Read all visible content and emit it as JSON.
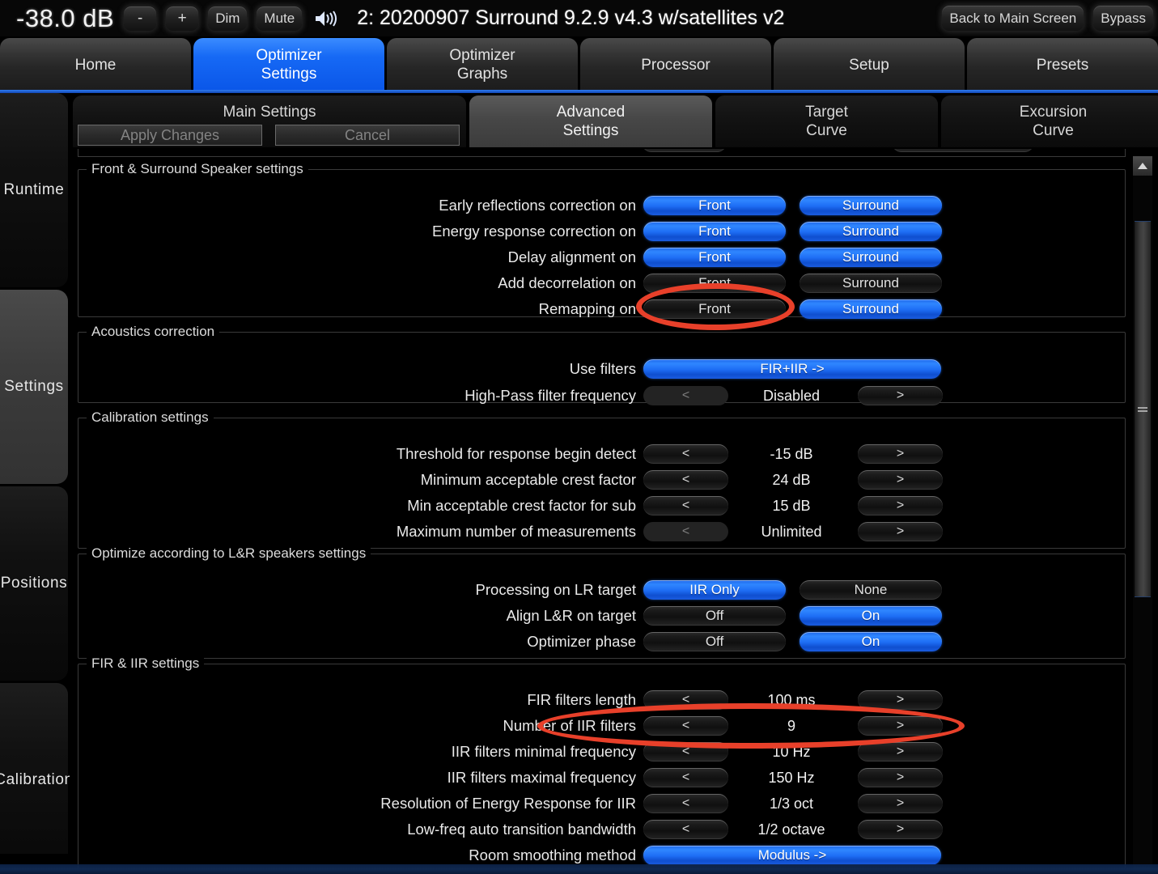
{
  "header": {
    "volume": "-38.0 dB",
    "minus_label": "-",
    "plus_label": "+",
    "dim_label": "Dim",
    "mute_label": "Mute",
    "speaker_icon": "speaker-volume-icon",
    "title": "2: 20200907 Surround 9.2.9 v4.3 w/satellites v2",
    "back_label": "Back to Main Screen",
    "bypass_label": "Bypass"
  },
  "main_tabs": [
    {
      "line1": "Home",
      "line2": "",
      "active": false
    },
    {
      "line1": "Optimizer",
      "line2": "Settings",
      "active": true
    },
    {
      "line1": "Optimizer",
      "line2": "Graphs",
      "active": false
    },
    {
      "line1": "Processor",
      "line2": "",
      "active": false
    },
    {
      "line1": "Setup",
      "line2": "",
      "active": false
    },
    {
      "line1": "Presets",
      "line2": "",
      "active": false
    }
  ],
  "sidebar": {
    "items": [
      {
        "label": "Runtime",
        "active": false
      },
      {
        "label": "Settings",
        "active": true
      },
      {
        "label": "Positions",
        "active": false
      },
      {
        "label": "Calibration",
        "active": false
      }
    ]
  },
  "sub_tabs": [
    {
      "line1": "Main Settings",
      "line2": "",
      "active": false
    },
    {
      "line1": "Advanced",
      "line2": "Settings",
      "active": true
    },
    {
      "line1": "Target",
      "line2": "Curve",
      "active": false
    },
    {
      "line1": "Excursion",
      "line2": "Curve",
      "active": false
    }
  ],
  "actions": {
    "apply_label": "Apply Changes",
    "cancel_label": "Cancel"
  },
  "sections": {
    "front_surround": {
      "legend": "Front & Surround Speaker settings",
      "rows": [
        {
          "label": "Early reflections correction on",
          "left": "Front",
          "left_on": true,
          "right": "Surround",
          "right_on": true
        },
        {
          "label": "Energy response correction on",
          "left": "Front",
          "left_on": true,
          "right": "Surround",
          "right_on": true
        },
        {
          "label": "Delay alignment on",
          "left": "Front",
          "left_on": true,
          "right": "Surround",
          "right_on": true
        },
        {
          "label": "Add decorrelation on",
          "left": "Front",
          "left_on": false,
          "right": "Surround",
          "right_on": false
        },
        {
          "label": "Remapping on",
          "left": "Front",
          "left_on": false,
          "right": "Surround",
          "right_on": true
        }
      ]
    },
    "acoustics": {
      "legend": "Acoustics correction",
      "use_filters_label": "Use filters",
      "use_filters_value": "FIR+IIR ->",
      "hp_label": "High-Pass filter frequency",
      "hp_value": "Disabled",
      "hp_prev": "<",
      "hp_next": ">",
      "hp_prev_disabled": true
    },
    "calibration": {
      "legend": "Calibration settings",
      "rows": [
        {
          "label": "Threshold for response begin detect",
          "prev": "<",
          "value": "-15 dB",
          "next": ">",
          "prev_disabled": false
        },
        {
          "label": "Minimum acceptable crest factor",
          "prev": "<",
          "value": "24 dB",
          "next": ">",
          "prev_disabled": false
        },
        {
          "label": "Min acceptable crest factor for sub",
          "prev": "<",
          "value": "15 dB",
          "next": ">",
          "prev_disabled": false
        },
        {
          "label": "Maximum number of measurements",
          "prev": "<",
          "value": "Unlimited",
          "next": ">",
          "prev_disabled": true
        }
      ]
    },
    "lr_speakers": {
      "legend": "Optimize according to L&R speakers settings",
      "rows": [
        {
          "label": "Processing on LR target",
          "left": "IIR Only",
          "left_on": true,
          "right": "None",
          "right_on": false
        },
        {
          "label": "Align L&R on target",
          "left": "Off",
          "left_on": false,
          "right": "On",
          "right_on": true
        },
        {
          "label": "Optimizer phase",
          "left": "Off",
          "left_on": false,
          "right": "On",
          "right_on": true
        }
      ]
    },
    "fir_iir": {
      "legend": "FIR & IIR settings",
      "rows": [
        {
          "label": "FIR filters length",
          "prev": "<",
          "value": "100 ms",
          "next": ">"
        },
        {
          "label": "Number of IIR filters",
          "prev": "<",
          "value": "9",
          "next": ">"
        },
        {
          "label": "IIR filters minimal frequency",
          "prev": "<",
          "value": "10 Hz",
          "next": ">"
        },
        {
          "label": "IIR filters maximal frequency",
          "prev": "<",
          "value": "150 Hz",
          "next": ">"
        },
        {
          "label": "Resolution of Energy Response for IIR",
          "prev": "<",
          "value": "1/3 oct",
          "next": ">"
        },
        {
          "label": "Low-freq auto transition bandwidth",
          "prev": "<",
          "value": "1/2 octave",
          "next": ">"
        }
      ],
      "room_smoothing_label": "Room smoothing method",
      "room_smoothing_value": "Modulus ->"
    }
  },
  "scrollbar": {
    "up_icon": "chevron-up-icon",
    "grip_icon": "grip-lines-icon"
  },
  "annotations": {
    "color": "#e8402a",
    "ellipse_1_target": "Remapping on Front toggle",
    "ellipse_2_target": "Number of IIR filters row"
  },
  "colors": {
    "accent_blue": "#1e6ef5",
    "annotation_red": "#e8402a",
    "panel_black": "#000000"
  }
}
